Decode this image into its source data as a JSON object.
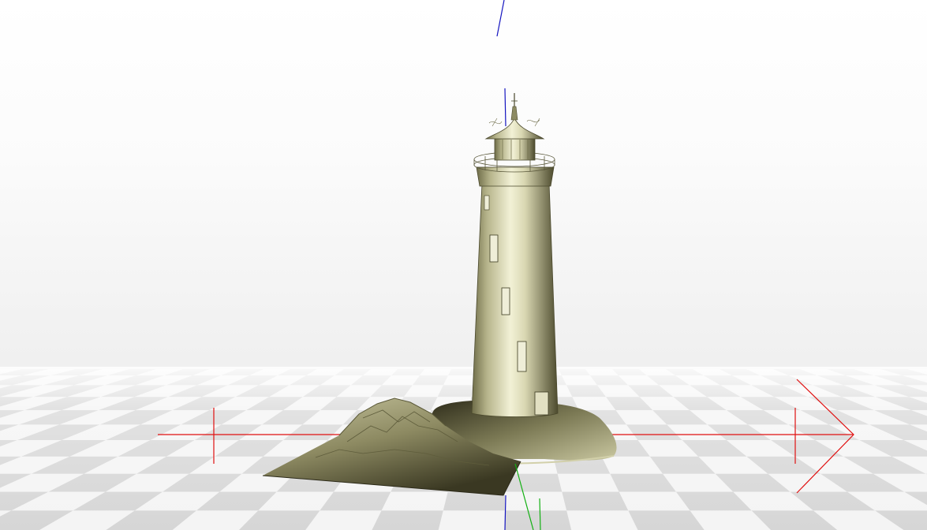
{
  "viewer": {
    "scene": "lighthouse-on-rocks",
    "background": {
      "top": "#ffffff",
      "bottom": "#e8e8e8"
    },
    "grid": {
      "light": "#f4f4f4",
      "dark": "#d6d6d6"
    },
    "model_color": "#c9c7a0",
    "axes": {
      "x_color": "#e01010",
      "y_color": "#10b010",
      "z_color": "#1010c0"
    }
  }
}
